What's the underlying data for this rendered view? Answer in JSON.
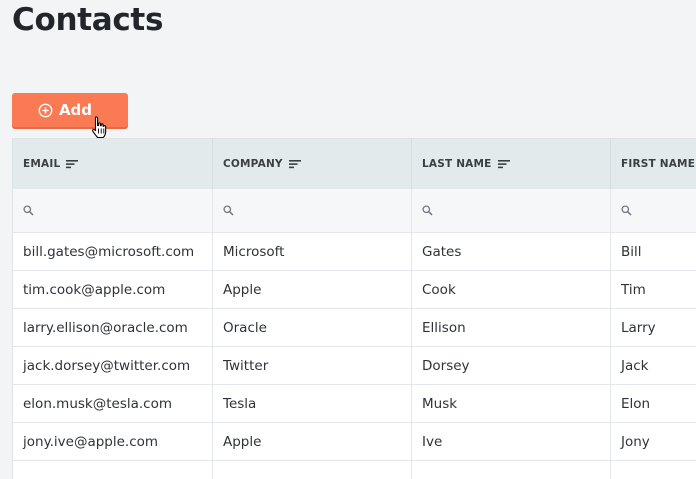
{
  "page": {
    "title": "Contacts"
  },
  "toolbar": {
    "add_label": "Add"
  },
  "table": {
    "columns": [
      "EMAIL",
      "COMPANY",
      "LAST NAME",
      "FIRST NAME"
    ],
    "rows": [
      [
        "bill.gates@microsoft.com",
        "Microsoft",
        "Gates",
        "Bill"
      ],
      [
        "tim.cook@apple.com",
        "Apple",
        "Cook",
        "Tim"
      ],
      [
        "larry.ellison@oracle.com",
        "Oracle",
        "Ellison",
        "Larry"
      ],
      [
        "jack.dorsey@twitter.com",
        "Twitter",
        "Dorsey",
        "Jack"
      ],
      [
        "elon.musk@tesla.com",
        "Tesla",
        "Musk",
        "Elon"
      ],
      [
        "jony.ive@apple.com",
        "Apple",
        "Ive",
        "Jony"
      ],
      [
        "",
        "",
        "",
        ""
      ]
    ]
  },
  "icons": {
    "add": "plus-circle-icon",
    "sort": "sort-lines-icon",
    "filter": "search-icon",
    "cursor": "hand-pointer-icon"
  },
  "colors": {
    "accent": "#fa7a53",
    "header_bg": "#e3eaec",
    "page_bg": "#f2f4f6"
  }
}
